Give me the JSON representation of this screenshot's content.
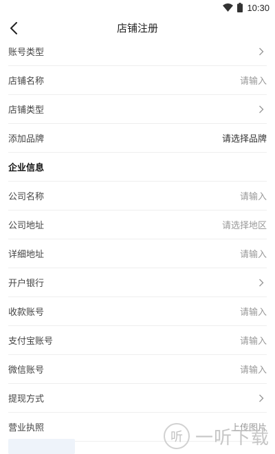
{
  "status_bar": {
    "time": "10:30",
    "icons": [
      "wifi-icon",
      "battery-icon"
    ]
  },
  "header": {
    "title": "店铺注册",
    "back_icon": "chevron-left-icon"
  },
  "form": {
    "account_type": {
      "label": "账号类型",
      "icon": "chevron-right-icon"
    },
    "shop_name": {
      "label": "店铺名称",
      "placeholder": "请输入"
    },
    "shop_type": {
      "label": "店铺类型",
      "icon": "chevron-right-icon"
    },
    "add_brand": {
      "label": "添加品牌",
      "value": "请选择品牌"
    },
    "enterprise_section": {
      "title": "企业信息"
    },
    "company_name": {
      "label": "公司名称",
      "placeholder": "请输入"
    },
    "company_address": {
      "label": "公司地址",
      "placeholder": "请选择地区"
    },
    "detail_address": {
      "label": "详细地址",
      "placeholder": "请输入"
    },
    "bank": {
      "label": "开户银行",
      "icon": "chevron-right-icon"
    },
    "receiving_account": {
      "label": "收款账号",
      "placeholder": "请输入"
    },
    "alipay_account": {
      "label": "支付宝账号",
      "placeholder": "请输入"
    },
    "wechat_account": {
      "label": "微信账号",
      "placeholder": "请输入"
    },
    "withdraw_method": {
      "label": "提现方式",
      "icon": "chevron-right-icon"
    },
    "business_license": {
      "label": "营业执照",
      "value": "上传图片"
    }
  },
  "watermark": {
    "logo_char": "听",
    "text": "一听下载"
  },
  "colors": {
    "divider": "#eeeeee",
    "placeholder": "#999999",
    "text": "#444444",
    "title": "#222222"
  }
}
